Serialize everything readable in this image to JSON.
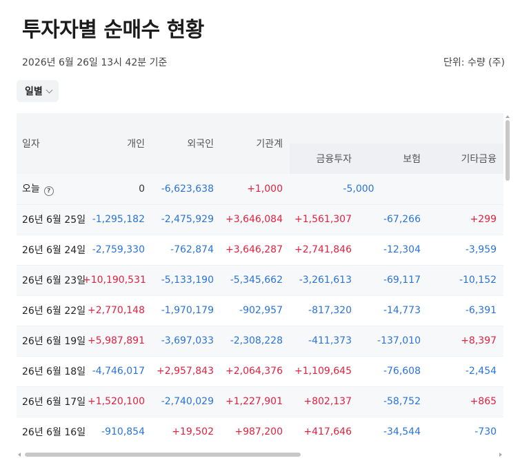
{
  "title": "투자자별 순매수 현황",
  "timestamp": "2026년 6월 26일 13시 42분 기준",
  "unit": "단위: 수량 (주)",
  "period_button": {
    "label": "일별",
    "icon": "chevron-down-icon"
  },
  "colors": {
    "positive": "#e2213f",
    "negative": "#2a73d9"
  },
  "table": {
    "columns": {
      "date": "일자",
      "individual": "개인",
      "foreign": "외국인",
      "institution": "기관계",
      "financial_investment": "금융투자",
      "insurance": "보험",
      "other_financial": "기타금융"
    },
    "today": {
      "date": "오늘",
      "help_icon": "question-icon",
      "individual": "0",
      "foreign": "-6,623,638",
      "institution": "+1,000",
      "institution_subtotal": "-5,000"
    },
    "rows": [
      {
        "date": "26년 6월 25일",
        "individual": "-1,295,182",
        "foreign": "-2,475,929",
        "institution": "+3,646,084",
        "financial_investment": "+1,561,307",
        "insurance": "-67,266",
        "other_financial": "+299"
      },
      {
        "date": "26년 6월 24일",
        "individual": "-2,759,330",
        "foreign": "-762,874",
        "institution": "+3,646,287",
        "financial_investment": "+2,741,846",
        "insurance": "-12,304",
        "other_financial": "-3,959"
      },
      {
        "date": "26년 6월 23일",
        "individual": "+10,190,531",
        "foreign": "-5,133,190",
        "institution": "-5,345,662",
        "financial_investment": "-3,261,613",
        "insurance": "-69,117",
        "other_financial": "-10,152"
      },
      {
        "date": "26년 6월 22일",
        "individual": "+2,770,148",
        "foreign": "-1,970,179",
        "institution": "-902,957",
        "financial_investment": "-817,320",
        "insurance": "-14,773",
        "other_financial": "-6,391"
      },
      {
        "date": "26년 6월 19일",
        "individual": "+5,987,891",
        "foreign": "-3,697,033",
        "institution": "-2,308,228",
        "financial_investment": "-411,373",
        "insurance": "-137,010",
        "other_financial": "+8,397"
      },
      {
        "date": "26년 6월 18일",
        "individual": "-4,746,017",
        "foreign": "+2,957,843",
        "institution": "+2,064,376",
        "financial_investment": "+1,109,645",
        "insurance": "-76,608",
        "other_financial": "-2,454"
      },
      {
        "date": "26년 6월 17일",
        "individual": "+1,520,100",
        "foreign": "-2,740,029",
        "institution": "+1,227,901",
        "financial_investment": "+802,137",
        "insurance": "-58,752",
        "other_financial": "+865"
      },
      {
        "date": "26년 6월 16일",
        "individual": "-910,854",
        "foreign": "+19,502",
        "institution": "+987,200",
        "financial_investment": "+417,646",
        "insurance": "-34,544",
        "other_financial": "-730"
      }
    ]
  }
}
